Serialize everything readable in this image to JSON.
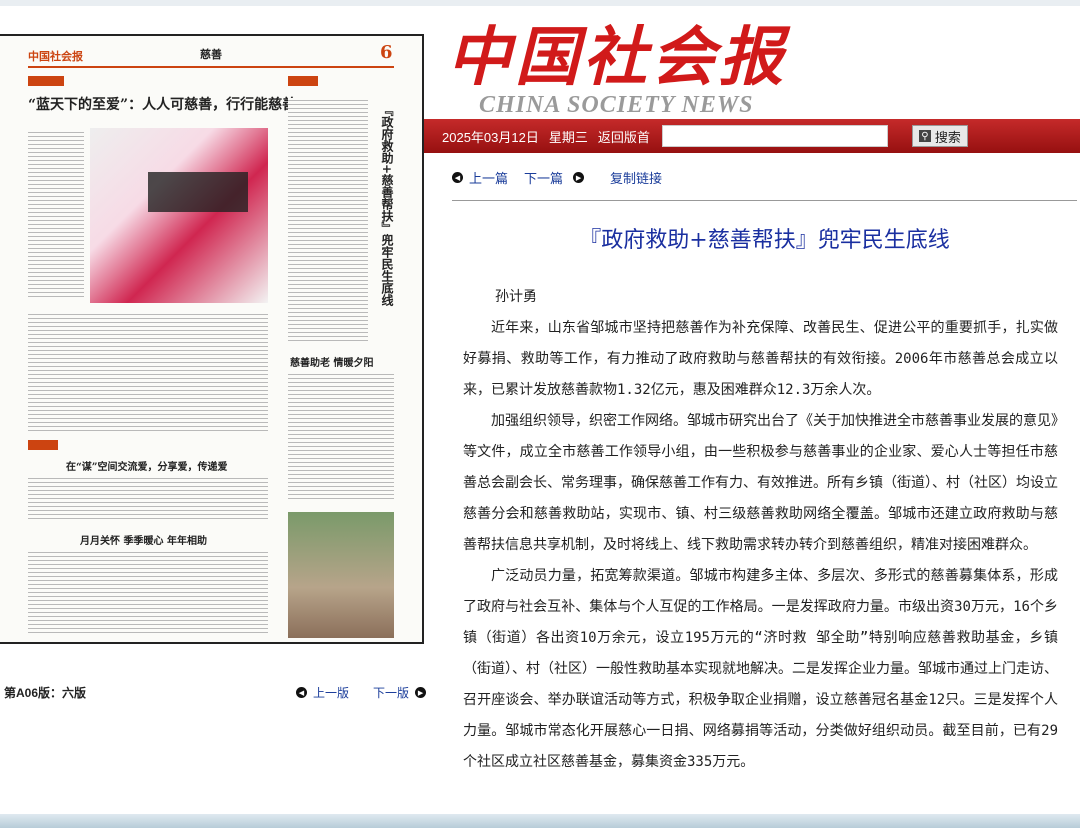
{
  "logo": {
    "cn": "中国社会报",
    "en": "CHINA SOCIETY NEWS"
  },
  "datebar": {
    "date": "2025年03月12日",
    "weekday": "星期三",
    "back_home": "返回版首",
    "search_value": "",
    "search_button": "搜索"
  },
  "article_nav": {
    "prev": "上一篇",
    "next": "下一篇",
    "copy_link": "复制链接"
  },
  "article": {
    "title": "『政府救助+慈善帮扶』兜牢民生底线",
    "author": "孙计勇",
    "paragraphs": [
      "近年来，山东省邹城市坚持把慈善作为补充保障、改善民生、促进公平的重要抓手，扎实做好募捐、救助等工作，有力推动了政府救助与慈善帮扶的有效衔接。2006年市慈善总会成立以来，已累计发放慈善款物1.32亿元，惠及困难群众12.3万余人次。",
      "加强组织领导，织密工作网络。邹城市研究出台了《关于加快推进全市慈善事业发展的意见》等文件，成立全市慈善工作领导小组，由一些积极参与慈善事业的企业家、爱心人士等担任市慈善总会副会长、常务理事，确保慈善工作有力、有效推进。所有乡镇（街道）、村（社区）均设立慈善分会和慈善救助站，实现市、镇、村三级慈善救助网络全覆盖。邹城市还建立政府救助与慈善帮扶信息共享机制，及时将线上、线下救助需求转办转介到慈善组织，精准对接困难群众。",
      "广泛动员力量，拓宽筹款渠道。邹城市构建多主体、多层次、多形式的慈善募集体系，形成了政府与社会互补、集体与个人互促的工作格局。一是发挥政府力量。市级出资30万元，16个乡镇（街道）各出资10万余元，设立195万元的“济时救 邹全助”特别响应慈善救助基金，乡镇（街道）、村（社区）一般性救助基本实现就地解决。二是发挥企业力量。邹城市通过上门走访、召开座谈会、举办联谊活动等方式，积极争取企业捐赠，设立慈善冠名基金12只。三是发挥个人力量。邹城市常态化开展慈心一日捐、网络募捐等活动，分类做好组织动员。截至目前，已有29个社区成立社区慈善基金，募集资金335万元。"
    ]
  },
  "paper": {
    "masthead": "中国社会报",
    "section": "慈善",
    "page_number": "6",
    "headline": "“蓝天下的至爱”：人人可慈善，行行能慈善",
    "vertical_headline": "『政府救助+慈善帮扶』兜牢民生底线",
    "sub1": "慈善助老 情暖夕阳",
    "sub2": "在“谋”空间交流爱，分享爱，传递爱",
    "sub3": "月月关怀 季季暖心 年年相助"
  },
  "page_nav": {
    "label": "第A06版：六版",
    "prev": "上一版",
    "next": "下一版"
  },
  "colors": {
    "brand_red": "#d11a1a",
    "bar_red": "#b51d1d",
    "link_blue": "#1a3c9a",
    "title_blue": "#1a2fa0"
  }
}
